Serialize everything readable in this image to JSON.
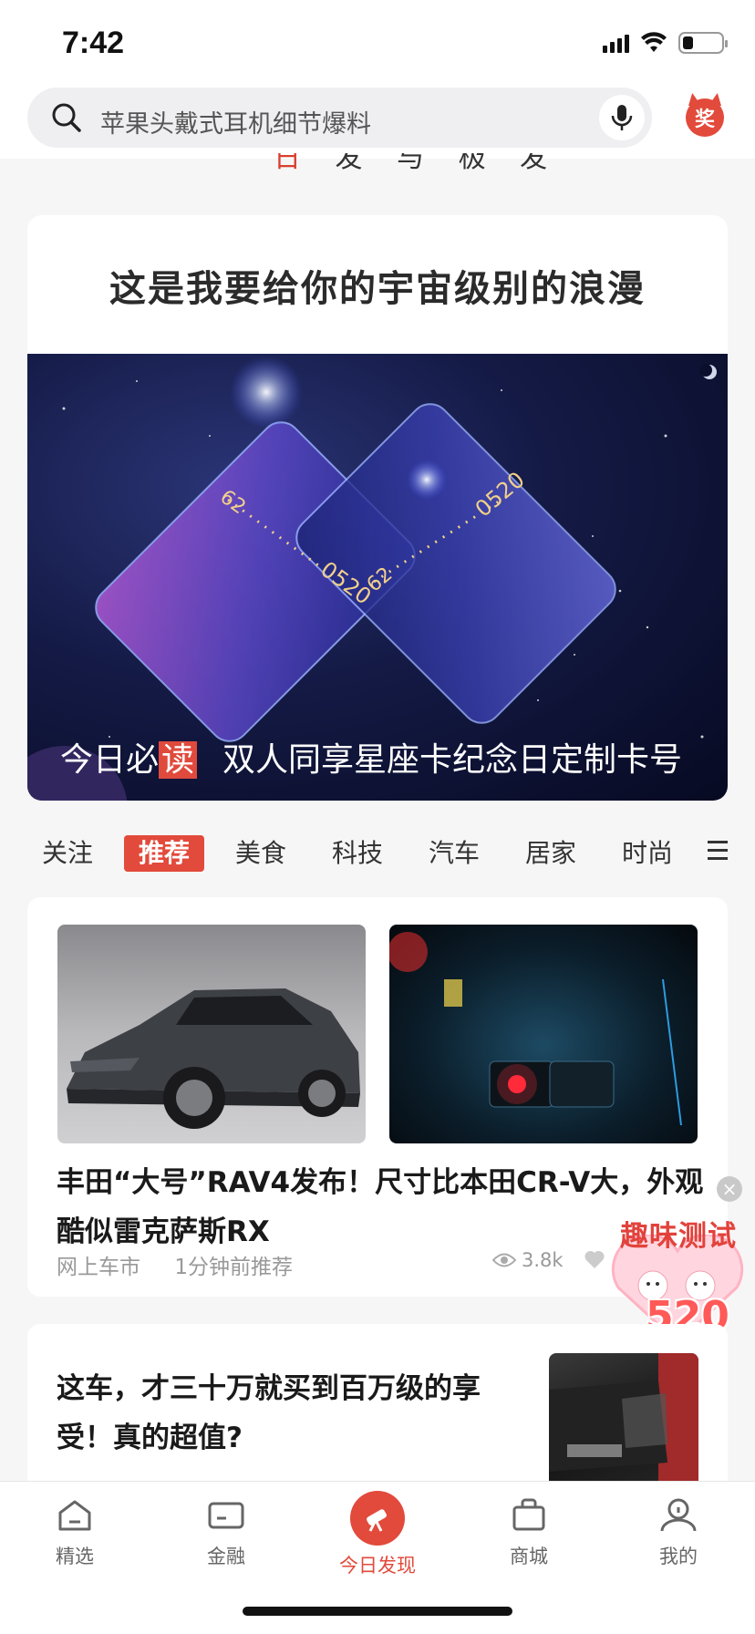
{
  "status_bar": {
    "time": "7:42"
  },
  "search": {
    "placeholder": "苹果头戴式耳机细节爆料"
  },
  "reward": {
    "label": "奖"
  },
  "banner_peek": {
    "text": "发 与 极 发"
  },
  "hero": {
    "title": "这是我要给你的宇宙级别的浪漫",
    "card_numbers": [
      "62",
      "0520",
      "62",
      "0520"
    ],
    "caption_prefix": "今日必",
    "caption_tag": "读",
    "caption_text": "双人同享星座卡纪念日定制卡号"
  },
  "tabs": [
    {
      "label": "关注",
      "active": false
    },
    {
      "label": "推荐",
      "active": true
    },
    {
      "label": "美食",
      "active": false
    },
    {
      "label": "科技",
      "active": false
    },
    {
      "label": "汽车",
      "active": false
    },
    {
      "label": "居家",
      "active": false
    },
    {
      "label": "时尚",
      "active": false
    }
  ],
  "article1": {
    "title": "丰田“大号”RAV4发布！尺寸比本田CR-V大，外观酷似雷克萨斯RX",
    "source": "网上车市",
    "time": "1分钟前推荐",
    "views": "3.8k"
  },
  "quiz": {
    "title": "趣味测试",
    "number": "520",
    "close": "×"
  },
  "article2": {
    "title": "这车，才三十万就买到百万级的享受！真的超值?"
  },
  "nav": [
    {
      "label": "精选",
      "icon": "home-icon",
      "active": false
    },
    {
      "label": "金融",
      "icon": "card-icon",
      "active": false
    },
    {
      "label": "今日发现",
      "icon": "telescope-icon",
      "active": true
    },
    {
      "label": "商城",
      "icon": "bag-icon",
      "active": false
    },
    {
      "label": "我的",
      "icon": "profile-icon",
      "active": false
    }
  ],
  "colors": {
    "accent": "#e24a3b",
    "background": "#f6f6f7"
  }
}
